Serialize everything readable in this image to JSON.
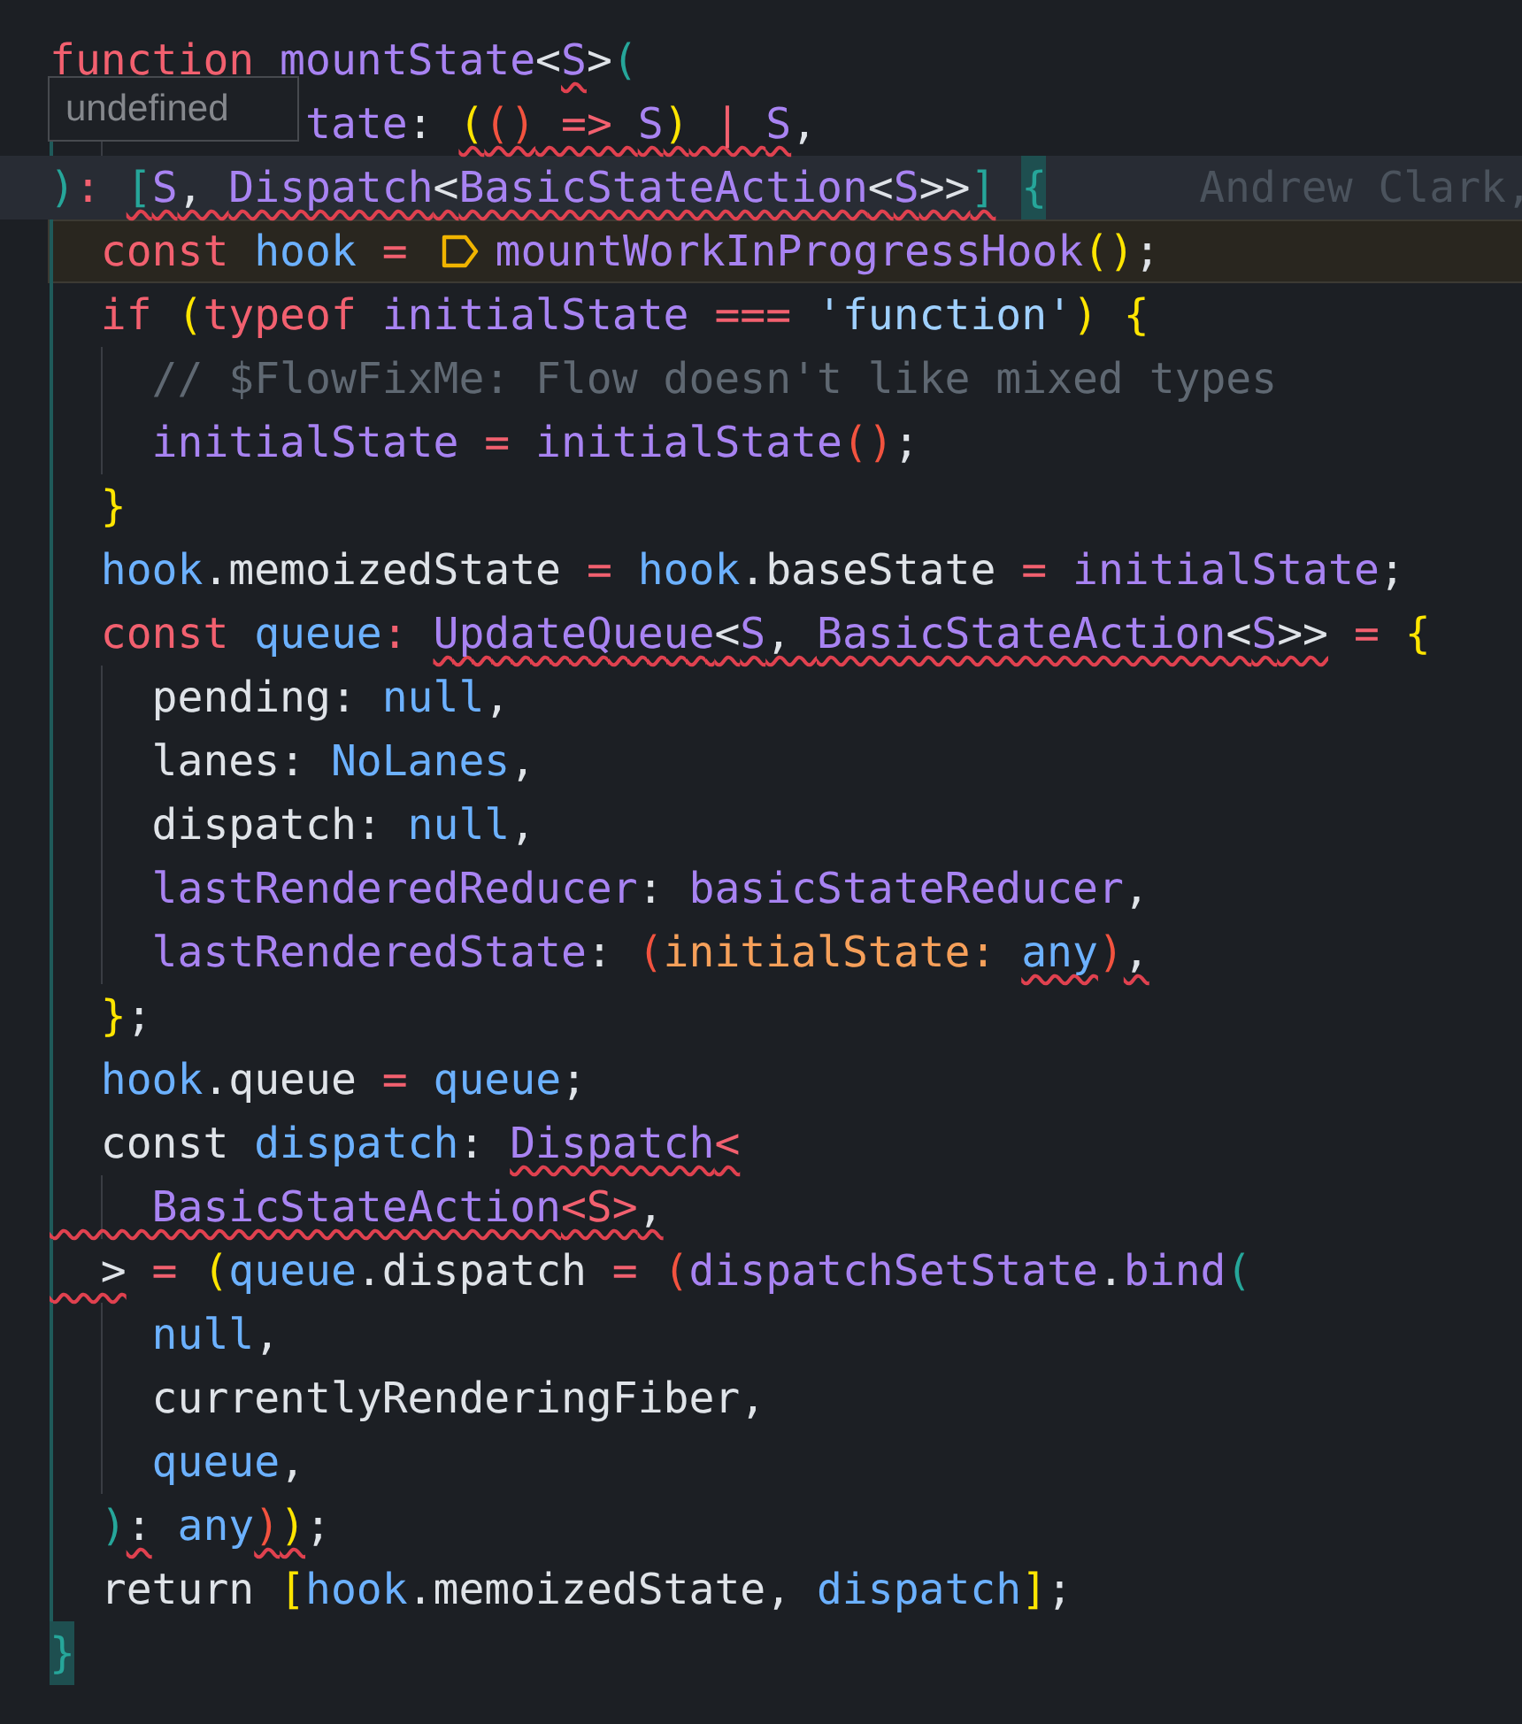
{
  "tooltip": {
    "text": "undefined"
  },
  "lines": [
    {
      "current": false,
      "marked": false,
      "tokens": [
        {
          "text": "function ",
          "kind": "kw"
        },
        {
          "text": "mountState",
          "kind": "fn",
          "error": false
        },
        {
          "text": "<",
          "kind": "plain",
          "error": false
        },
        {
          "text": "S",
          "kind": "fn",
          "error": true
        },
        {
          "text": ">",
          "kind": "plain",
          "error": false
        },
        {
          "text": "(",
          "kind": "teal",
          "error": false
        }
      ]
    },
    {
      "current": false,
      "marked": false,
      "tokens": [
        {
          "text": "          tate",
          "kind": "fn",
          "error": false
        },
        {
          "text": ": ",
          "kind": "plain",
          "error": false
        },
        {
          "text": "(",
          "kind": "yellow",
          "error": true
        },
        {
          "text": "()",
          "kind": "red",
          "error": true
        },
        {
          "text": " => ",
          "kind": "kw",
          "error": true
        },
        {
          "text": "S",
          "kind": "fn",
          "error": true
        },
        {
          "text": ")",
          "kind": "yellow",
          "error": true
        },
        {
          "text": " | ",
          "kind": "kw",
          "error": true
        },
        {
          "text": "S",
          "kind": "fn",
          "error": true
        },
        {
          "text": ",",
          "kind": "plain",
          "error": false
        }
      ]
    },
    {
      "current": true,
      "marked": false,
      "blame": "Andrew Clark,",
      "tokens": [
        {
          "text": ")",
          "kind": "teal",
          "error": false
        },
        {
          "text": ": ",
          "kind": "kw",
          "error": false
        },
        {
          "text": "[",
          "kind": "teal",
          "error": true
        },
        {
          "text": "S",
          "kind": "fn",
          "error": true
        },
        {
          "text": ", ",
          "kind": "plain",
          "error": true
        },
        {
          "text": "Dispatch",
          "kind": "fn",
          "error": true
        },
        {
          "text": "<",
          "kind": "plain",
          "error": true
        },
        {
          "text": "BasicStateAction",
          "kind": "fn",
          "error": true
        },
        {
          "text": "<",
          "kind": "plain",
          "error": true
        },
        {
          "text": "S",
          "kind": "fn",
          "error": true
        },
        {
          "text": ">>",
          "kind": "plain",
          "error": true
        },
        {
          "text": "]",
          "kind": "teal",
          "error": true
        },
        {
          "text": " {",
          "kind": "match",
          "error": false
        }
      ]
    },
    {
      "current": false,
      "marked": true,
      "tokens": [
        {
          "text": "  const ",
          "kind": "kw",
          "error": false
        },
        {
          "text": "hook ",
          "kind": "var",
          "error": false
        },
        {
          "text": "= ",
          "kind": "kw",
          "error": false
        },
        {
          "kind": "hint-icon",
          "error": false
        },
        {
          "text": "mountWorkInProgressHook",
          "kind": "fn",
          "error": false
        },
        {
          "text": "()",
          "kind": "yellow",
          "error": false
        },
        {
          "text": ";",
          "kind": "plain",
          "error": false
        }
      ]
    },
    {
      "current": false,
      "marked": false,
      "tokens": [
        {
          "text": "  if ",
          "kind": "kw",
          "error": false
        },
        {
          "text": "(",
          "kind": "yellow",
          "error": false
        },
        {
          "text": "typeof ",
          "kind": "kw",
          "error": false
        },
        {
          "text": "initialState ",
          "kind": "fn",
          "error": false
        },
        {
          "text": "=== ",
          "kind": "kw",
          "error": false
        },
        {
          "text": "'function'",
          "kind": "str",
          "error": false
        },
        {
          "text": ") {",
          "kind": "yellow",
          "error": false
        }
      ]
    },
    {
      "current": false,
      "marked": false,
      "tokens": [
        {
          "text": "    // $FlowFixMe: Flow doesn't like mixed types",
          "kind": "cmt",
          "error": false
        }
      ]
    },
    {
      "current": false,
      "marked": false,
      "tokens": [
        {
          "text": "    initialState ",
          "kind": "fn",
          "error": false
        },
        {
          "text": "= ",
          "kind": "kw",
          "error": false
        },
        {
          "text": "initialState",
          "kind": "fn",
          "error": false
        },
        {
          "text": "()",
          "kind": "red",
          "error": false
        },
        {
          "text": ";",
          "kind": "plain",
          "error": false
        }
      ]
    },
    {
      "current": false,
      "marked": false,
      "tokens": [
        {
          "text": "  }",
          "kind": "yellow",
          "error": false
        }
      ]
    },
    {
      "current": false,
      "marked": false,
      "tokens": [
        {
          "text": "  hook",
          "kind": "var",
          "error": false
        },
        {
          "text": ".memoizedState ",
          "kind": "plain",
          "error": false
        },
        {
          "text": "= ",
          "kind": "kw",
          "error": false
        },
        {
          "text": "hook",
          "kind": "var",
          "error": false
        },
        {
          "text": ".baseState ",
          "kind": "plain",
          "error": false
        },
        {
          "text": "= ",
          "kind": "kw",
          "error": false
        },
        {
          "text": "initialState",
          "kind": "fn",
          "error": false
        },
        {
          "text": ";",
          "kind": "plain",
          "error": false
        }
      ]
    },
    {
      "current": false,
      "marked": false,
      "tokens": [
        {
          "text": "  const ",
          "kind": "kw",
          "error": false
        },
        {
          "text": "queue",
          "kind": "var",
          "error": false
        },
        {
          "text": ": ",
          "kind": "kw",
          "error": false
        },
        {
          "text": "UpdateQueue",
          "kind": "fn",
          "error": true
        },
        {
          "text": "<",
          "kind": "plain",
          "error": true
        },
        {
          "text": "S",
          "kind": "fn",
          "error": true
        },
        {
          "text": ", ",
          "kind": "plain",
          "error": true
        },
        {
          "text": "BasicStateAction",
          "kind": "fn",
          "error": true
        },
        {
          "text": "<",
          "kind": "plain",
          "error": true
        },
        {
          "text": "S",
          "kind": "fn",
          "error": true
        },
        {
          "text": ">>",
          "kind": "plain",
          "error": true
        },
        {
          "text": " = ",
          "kind": "kw",
          "error": false
        },
        {
          "text": "{",
          "kind": "yellow",
          "error": false
        }
      ]
    },
    {
      "current": false,
      "marked": false,
      "tokens": [
        {
          "text": "    pending: ",
          "kind": "plain",
          "error": false
        },
        {
          "text": "null",
          "kind": "var",
          "error": false
        },
        {
          "text": ",",
          "kind": "plain",
          "error": false
        }
      ]
    },
    {
      "current": false,
      "marked": false,
      "tokens": [
        {
          "text": "    lanes: ",
          "kind": "plain",
          "error": false
        },
        {
          "text": "NoLanes",
          "kind": "var",
          "error": false
        },
        {
          "text": ",",
          "kind": "plain",
          "error": false
        }
      ]
    },
    {
      "current": false,
      "marked": false,
      "tokens": [
        {
          "text": "    dispatch: ",
          "kind": "plain",
          "error": false
        },
        {
          "text": "null",
          "kind": "var",
          "error": false
        },
        {
          "text": ",",
          "kind": "plain",
          "error": false
        }
      ]
    },
    {
      "current": false,
      "marked": false,
      "tokens": [
        {
          "text": "    lastRenderedReducer",
          "kind": "fn",
          "error": false
        },
        {
          "text": ": ",
          "kind": "plain",
          "error": false
        },
        {
          "text": "basicStateReducer",
          "kind": "fn",
          "error": false
        },
        {
          "text": ",",
          "kind": "plain",
          "error": false
        }
      ]
    },
    {
      "current": false,
      "marked": false,
      "tokens": [
        {
          "text": "    lastRenderedState",
          "kind": "fn",
          "error": false
        },
        {
          "text": ": ",
          "kind": "plain",
          "error": false
        },
        {
          "text": "(",
          "kind": "red",
          "error": false
        },
        {
          "text": "initialState: ",
          "kind": "orange",
          "error": false
        },
        {
          "text": "any",
          "kind": "var",
          "error": true
        },
        {
          "text": ")",
          "kind": "red",
          "error": false
        },
        {
          "text": ",",
          "kind": "plain",
          "error": true
        }
      ]
    },
    {
      "current": false,
      "marked": false,
      "tokens": [
        {
          "text": "  }",
          "kind": "yellow",
          "error": false
        },
        {
          "text": ";",
          "kind": "plain",
          "error": false
        }
      ]
    },
    {
      "current": false,
      "marked": false,
      "tokens": [
        {
          "text": "  hook",
          "kind": "var",
          "error": false
        },
        {
          "text": ".queue ",
          "kind": "plain",
          "error": false
        },
        {
          "text": "= ",
          "kind": "kw",
          "error": false
        },
        {
          "text": "queue",
          "kind": "var",
          "error": false
        },
        {
          "text": ";",
          "kind": "plain",
          "error": false
        }
      ]
    },
    {
      "current": false,
      "marked": false,
      "tokens": [
        {
          "text": "  const ",
          "kind": "plain",
          "error": false
        },
        {
          "text": "dispatch",
          "kind": "var",
          "error": false
        },
        {
          "text": ": ",
          "kind": "plain",
          "error": false
        },
        {
          "text": "Dispatch",
          "kind": "fn",
          "error": true
        },
        {
          "text": "<",
          "kind": "kw",
          "error": true
        }
      ]
    },
    {
      "current": false,
      "marked": false,
      "tokens": [
        {
          "text": "    BasicStateAction",
          "kind": "fn",
          "error": true
        },
        {
          "text": "<S>",
          "kind": "kw",
          "error": true
        },
        {
          "text": ",",
          "kind": "plain",
          "error": true
        }
      ]
    },
    {
      "current": false,
      "marked": false,
      "tokens": [
        {
          "text": "  >",
          "kind": "plain",
          "error": true
        },
        {
          "text": " = ",
          "kind": "kw",
          "error": false
        },
        {
          "text": "(",
          "kind": "yellow",
          "error": false
        },
        {
          "text": "queue",
          "kind": "var",
          "error": false
        },
        {
          "text": ".dispatch ",
          "kind": "plain",
          "error": false
        },
        {
          "text": "= ",
          "kind": "kw",
          "error": false
        },
        {
          "text": "(",
          "kind": "red",
          "error": false
        },
        {
          "text": "dispatchSetState",
          "kind": "fn",
          "error": false
        },
        {
          "text": ".",
          "kind": "plain",
          "error": false
        },
        {
          "text": "bind",
          "kind": "fn",
          "error": false
        },
        {
          "text": "(",
          "kind": "teal",
          "error": false
        }
      ]
    },
    {
      "current": false,
      "marked": false,
      "tokens": [
        {
          "text": "    null",
          "kind": "var",
          "error": false
        },
        {
          "text": ",",
          "kind": "plain",
          "error": false
        }
      ]
    },
    {
      "current": false,
      "marked": false,
      "tokens": [
        {
          "text": "    currentlyRenderingFiber,",
          "kind": "plain",
          "error": false
        }
      ]
    },
    {
      "current": false,
      "marked": false,
      "tokens": [
        {
          "text": "    queue",
          "kind": "var",
          "error": false
        },
        {
          "text": ",",
          "kind": "plain",
          "error": false
        }
      ]
    },
    {
      "current": false,
      "marked": false,
      "tokens": [
        {
          "text": "  )",
          "kind": "teal",
          "error": false
        },
        {
          "text": ":",
          "kind": "plain",
          "error": true
        },
        {
          "text": " any",
          "kind": "var",
          "error": false
        },
        {
          "text": ")",
          "kind": "red",
          "error": true
        },
        {
          "text": ")",
          "kind": "yellow",
          "error": true
        },
        {
          "text": ";",
          "kind": "plain",
          "error": false
        }
      ]
    },
    {
      "current": false,
      "marked": false,
      "tokens": [
        {
          "text": "  return ",
          "kind": "plain",
          "error": false
        },
        {
          "text": "[",
          "kind": "yellow",
          "error": false
        },
        {
          "text": "hook",
          "kind": "var",
          "error": false
        },
        {
          "text": ".memoizedState, ",
          "kind": "plain",
          "error": false
        },
        {
          "text": "dispatch",
          "kind": "var",
          "error": false
        },
        {
          "text": "]",
          "kind": "yellow",
          "error": false
        },
        {
          "text": ";",
          "kind": "plain",
          "error": false
        }
      ]
    },
    {
      "current": false,
      "marked": false,
      "tokens": [
        {
          "text": "}",
          "kind": "match",
          "error": false
        }
      ]
    }
  ]
}
